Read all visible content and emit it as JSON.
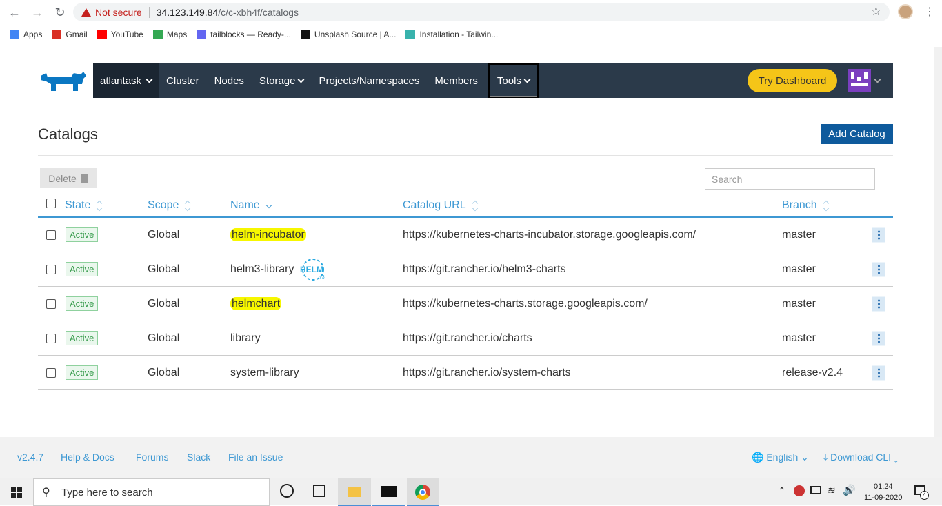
{
  "browser": {
    "security_label": "Not secure",
    "url_host": "34.123.149.84",
    "url_path": "/c/c-xbh4f/catalogs",
    "bookmarks": [
      {
        "label": "Apps",
        "icon": "apps-grid-icon"
      },
      {
        "label": "Gmail",
        "icon": "gmail-icon"
      },
      {
        "label": "YouTube",
        "icon": "youtube-icon"
      },
      {
        "label": "Maps",
        "icon": "maps-icon"
      },
      {
        "label": "tailblocks — Ready-...",
        "icon": "tailblocks-icon"
      },
      {
        "label": "Unsplash Source | A...",
        "icon": "unsplash-icon"
      },
      {
        "label": "Installation - Tailwin...",
        "icon": "tailwind-icon"
      }
    ]
  },
  "nav": {
    "cluster": "atlantask",
    "items": [
      "Cluster",
      "Nodes",
      "Storage",
      "Projects/Namespaces",
      "Members",
      "Tools"
    ],
    "try_dashboard": "Try Dashboard",
    "colors": {
      "bg": "#2b3a4a",
      "cluster_bg": "#1b2632",
      "accent": "#f5c518"
    }
  },
  "page": {
    "title": "Catalogs",
    "add_button": "Add Catalog",
    "delete_button": "Delete",
    "search_placeholder": "Search"
  },
  "table": {
    "headers": [
      "State",
      "Scope",
      "Name",
      "Catalog URL",
      "Branch"
    ],
    "rows": [
      {
        "state": "Active",
        "scope": "Global",
        "name": "helm-incubator",
        "url": "https://kubernetes-charts-incubator.storage.googleapis.com/",
        "branch": "master",
        "highlight": true,
        "helm_badge": false
      },
      {
        "state": "Active",
        "scope": "Global",
        "name": "helm3-library",
        "url": "https://git.rancher.io/helm3-charts",
        "branch": "master",
        "highlight": false,
        "helm_badge": true
      },
      {
        "state": "Active",
        "scope": "Global",
        "name": "helmchart",
        "url": "https://kubernetes-charts.storage.googleapis.com/",
        "branch": "master",
        "highlight": true,
        "helm_badge": false
      },
      {
        "state": "Active",
        "scope": "Global",
        "name": "library",
        "url": "https://git.rancher.io/charts",
        "branch": "master",
        "highlight": false,
        "helm_badge": false
      },
      {
        "state": "Active",
        "scope": "Global",
        "name": "system-library",
        "url": "https://git.rancher.io/system-charts",
        "branch": "release-v2.4",
        "highlight": false,
        "helm_badge": false
      }
    ],
    "helm_badge_text": "HELM",
    "helm_badge_sub": "v3"
  },
  "footer": {
    "version": "v2.4.7",
    "links": [
      "Help & Docs",
      "Forums",
      "Slack",
      "File an Issue"
    ],
    "language": "English",
    "download": "Download CLI"
  },
  "taskbar": {
    "search_placeholder": "Type here to search",
    "time": "01:24",
    "date": "11-09-2020",
    "notification_count": "4"
  }
}
